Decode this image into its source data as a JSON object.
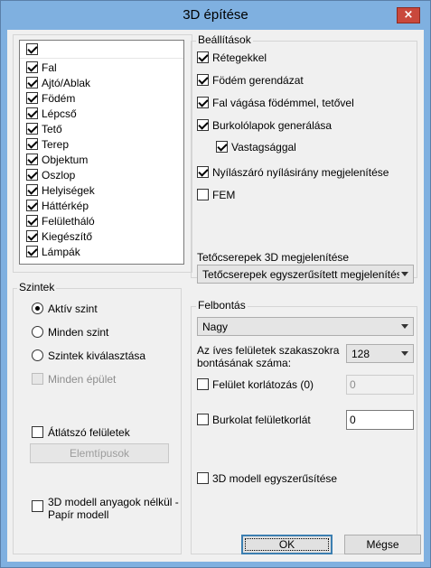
{
  "window": {
    "title": "3D építése",
    "close_glyph": "×"
  },
  "layers": {
    "header_checked": true,
    "items": [
      {
        "label": "Fal",
        "checked": true
      },
      {
        "label": "Ajtó/Ablak",
        "checked": true
      },
      {
        "label": "Födém",
        "checked": true
      },
      {
        "label": "Lépcső",
        "checked": true
      },
      {
        "label": "Tető",
        "checked": true
      },
      {
        "label": "Terep",
        "checked": true
      },
      {
        "label": "Objektum",
        "checked": true
      },
      {
        "label": "Oszlop",
        "checked": true
      },
      {
        "label": "Helyiségek",
        "checked": true
      },
      {
        "label": "Háttérkép",
        "checked": true
      },
      {
        "label": "Felületháló",
        "checked": true
      },
      {
        "label": "Kiegészítő",
        "checked": true
      },
      {
        "label": "Lámpák",
        "checked": true
      }
    ]
  },
  "levels": {
    "title": "Szintek",
    "radio_active": "Aktív szint",
    "radio_all": "Minden szint",
    "radio_select": "Szintek kiválasztása",
    "all_buildings": "Minden épület",
    "transparent": "Átlátszó felületek",
    "element_types_button": "Elemtípusok",
    "paper_model_line1": "3D modell anyagok nélkül -",
    "paper_model_line2": "Papír modell"
  },
  "settings": {
    "title": "Beállítások",
    "layers_opt": "Rétegekkel",
    "slab_beams": "Födém gerendázat",
    "wall_cut": "Fal vágása födémmel, tetővel",
    "tiles": "Burkolólapok generálása",
    "thickness": "Vastagsággal",
    "opening_dir": "Nyílászáró nyílásirány megjelenítése",
    "fem": "FEM",
    "roof_tiles_label": "Tetőcserepek 3D megjelenítése",
    "roof_tiles_value": "Tetőcserepek egyszerűsített megjelenítése (g"
  },
  "resolution": {
    "title": "Felbontás",
    "quality_value": "Nagy",
    "arc_label_line1": "Az íves felületek szakaszokra",
    "arc_label_line2": "bontásának száma:",
    "arc_value": "128",
    "surface_limit_label": "Felület korlátozás (0)",
    "surface_limit_value": "0",
    "cover_limit_label": "Burkolat felületkorlát",
    "cover_limit_value": "0",
    "simplify_label": "3D modell egyszerűsítése"
  },
  "buttons": {
    "ok": "OK",
    "cancel": "Mégse"
  }
}
